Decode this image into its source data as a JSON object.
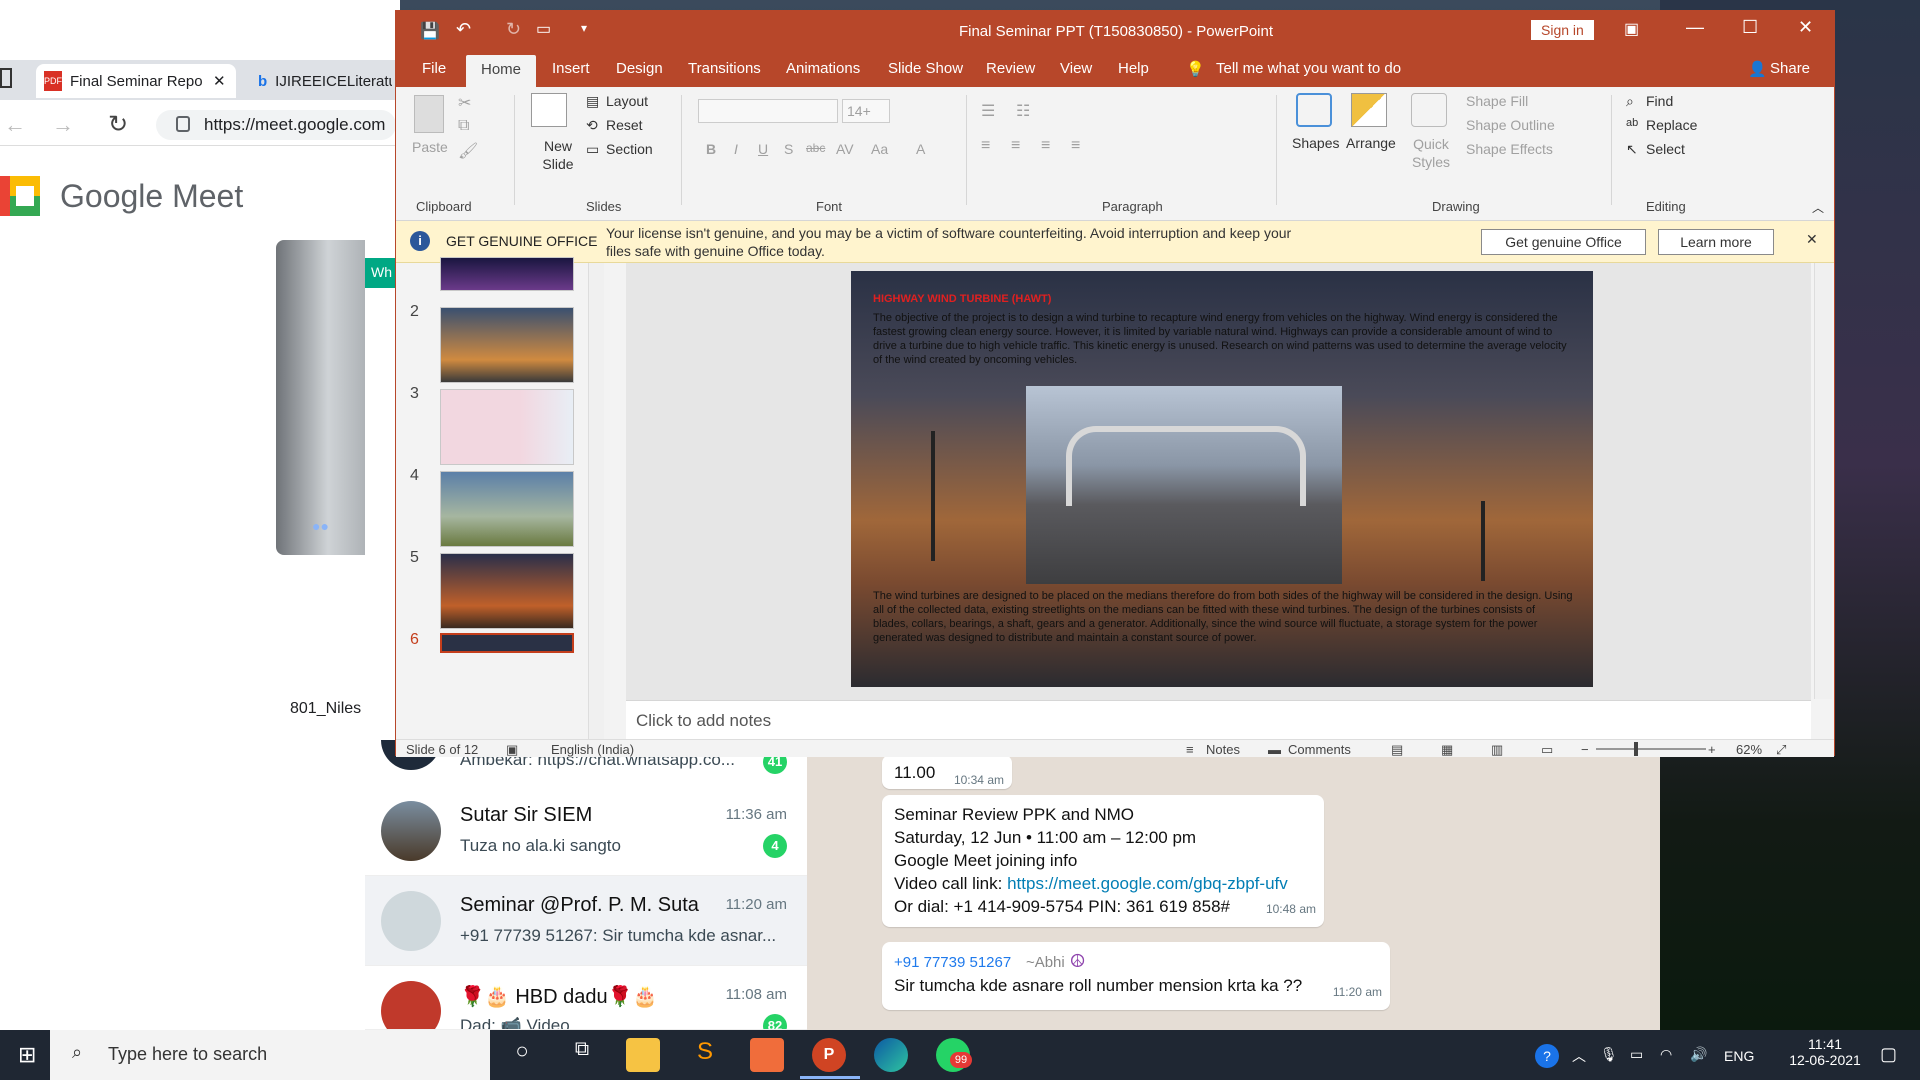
{
  "browser": {
    "tab1": "Final Seminar Repo",
    "tab2": "IJIREEICELiteratu",
    "url": "https://meet.google.com",
    "meet_title": "Google Meet",
    "participant": "801_Niles"
  },
  "whatsapp": {
    "partial_item": "Ambekar: https://chat.whatsapp.co...",
    "partial_badge": "41",
    "chats": [
      {
        "name": "Sutar Sir SIEM",
        "time": "11:36 am",
        "msg": "Tuza no ala.ki sangto",
        "badge": "4"
      },
      {
        "name": "Seminar @Prof. P. M. Suta",
        "time": "11:20 am",
        "msg": "+91 77739 51267: Sir tumcha kde asnar...",
        "badge": ""
      },
      {
        "name": "🌹🎂 HBD dadu🌹🎂",
        "time": "11:08 am",
        "msg": "Dad: 📹 Video",
        "badge": "82"
      }
    ],
    "bubble1_text": "11.00",
    "bubble1_time": "10:34 am",
    "bubble2_lines": [
      "Seminar Review PPK and NMO",
      "Saturday, 12 Jun  •  11:00 am – 12:00 pm",
      "Google Meet joining info"
    ],
    "bubble2_link_prefix": "Video call link: ",
    "bubble2_link": "https://meet.google.com/gbq-zbpf-ufv",
    "bubble2_dial": "Or dial: +1 414-909-5754 PIN: 361 619 858#",
    "bubble2_time": "10:48 am",
    "bubble3_sender": "+91 77739 51267",
    "bubble3_alias": "~Abhi",
    "bubble3_text": "Sir tumcha kde asnare roll number mension krta ka ??",
    "bubble3_time": "11:20 am"
  },
  "ppt": {
    "title": "Final Seminar PPT (T150830850)  -  PowerPoint",
    "sign_in": "Sign in",
    "menu": [
      "File",
      "Home",
      "Insert",
      "Design",
      "Transitions",
      "Animations",
      "Slide Show",
      "Review",
      "View",
      "Help"
    ],
    "tell_me": "Tell me what you want to do",
    "share": "Share",
    "ribbon": {
      "paste": "Paste",
      "clipboard": "Clipboard",
      "new_slide": "New Slide",
      "layout": "Layout",
      "reset": "Reset",
      "section": "Section",
      "slides": "Slides",
      "font_size": "14+",
      "font": "Font",
      "paragraph": "Paragraph",
      "shapes": "Shapes",
      "arrange": "Arrange",
      "quick_styles": "Quick Styles",
      "shape_fill": "Shape Fill",
      "shape_outline": "Shape Outline",
      "shape_effects": "Shape Effects",
      "drawing": "Drawing",
      "find": "Find",
      "replace": "Replace",
      "select": "Select",
      "editing": "Editing"
    },
    "banner": {
      "title": "GET GENUINE OFFICE",
      "text": "Your license isn't genuine, and you may be a victim of software counterfeiting. Avoid interruption and keep your files safe with genuine Office today.",
      "btn1": "Get genuine Office",
      "btn2": "Learn more"
    },
    "thumb_numbers": [
      "2",
      "3",
      "4",
      "5",
      "6"
    ],
    "slide": {
      "heading": "HIGHWAY WIND TURBINE (HAWT)",
      "para1": "The objective of the project is to design a wind turbine to recapture wind energy from vehicles on the highway. Wind energy is considered the fastest growing clean energy source. However, it is limited by variable natural wind. Highways can provide a considerable amount of wind to drive a turbine due to high vehicle traffic. This kinetic energy is unused. Research on wind patterns was used to determine the average velocity of the wind created by oncoming vehicles.",
      "para2": " The wind turbines are designed to be placed on the medians therefore do  from both sides of the highway will be considered in the design. Using all of the collected data, existing streetlights on the medians can be fitted with these wind turbines. The design of the turbines consists of blades, collars, bearings, a shaft, gears and a generator. Additionally, since the wind source will fluctuate, a storage system for the power generated was designed to distribute and maintain a constant source of power."
    },
    "notes_placeholder": "Click to add notes",
    "status": {
      "slide_of": "Slide 6 of 12",
      "language": "English (India)",
      "notes": "Notes",
      "comments": "Comments",
      "zoom": "62%"
    }
  },
  "taskbar": {
    "search_placeholder": "Type here to search",
    "lang": "ENG",
    "time": "11:41",
    "date": "12-06-2021",
    "whatsapp_badge": "99"
  }
}
